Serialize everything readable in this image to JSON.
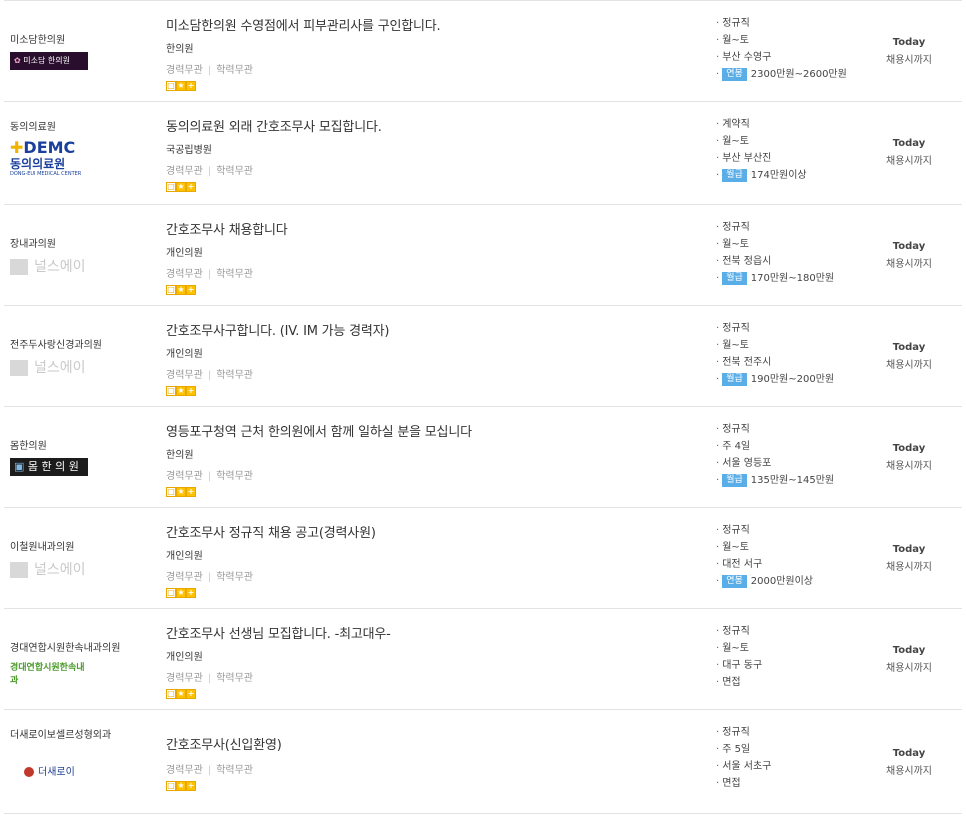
{
  "jobs": [
    {
      "company": "미소담한의원",
      "logo_text": "미소담 한의원",
      "title": "미소담한의원 수영점에서 피부관리사를 구인합니다.",
      "org": "한의원",
      "experience": "경력무관",
      "education": "학력무관",
      "conditions": [
        "정규직",
        "월~토",
        "부산 수영구"
      ],
      "pay_type": "연봉",
      "pay": "2300만원~2600만원",
      "deadline_1": "Today",
      "deadline_2": "채용시까지"
    },
    {
      "company": "동의의료원",
      "logo_text": "DEMC 동의의료원",
      "logo_sub": "DONG-EUI MEDICAL CENTER",
      "title": "동의의료원 외래 간호조무사 모집합니다.",
      "org": "국공립병원",
      "experience": "경력무관",
      "education": "학력무관",
      "conditions": [
        "계약직",
        "월~토",
        "부산 부산진"
      ],
      "pay_type": "월급",
      "pay": "174만원이상",
      "deadline_1": "Today",
      "deadline_2": "채용시까지"
    },
    {
      "company": "장내과의원",
      "logo_text": "널스에이",
      "title": "간호조무사 채용합니다",
      "org": "개인의원",
      "experience": "경력무관",
      "education": "학력무관",
      "conditions": [
        "정규직",
        "월~토",
        "전북 정읍시"
      ],
      "pay_type": "월급",
      "pay": "170만원~180만원",
      "deadline_1": "Today",
      "deadline_2": "채용시까지"
    },
    {
      "company": "전주두사랑신경과의원",
      "logo_text": "널스에이",
      "title": "간호조무사구합니다. (IV. IM 가능 경력자)",
      "org": "개인의원",
      "experience": "경력무관",
      "education": "학력무관",
      "conditions": [
        "정규직",
        "월~토",
        "전북 전주시"
      ],
      "pay_type": "월급",
      "pay": "190만원~200만원",
      "deadline_1": "Today",
      "deadline_2": "채용시까지"
    },
    {
      "company": "몸한의원",
      "logo_text": "몸 한 의 원",
      "title": "영등포구청역 근처 한의원에서 함께 일하실 분을 모십니다",
      "org": "한의원",
      "experience": "경력무관",
      "education": "학력무관",
      "conditions": [
        "정규직",
        "주 4일",
        "서울 영등포"
      ],
      "pay_type": "월급",
      "pay": "135만원~145만원",
      "deadline_1": "Today",
      "deadline_2": "채용시까지"
    },
    {
      "company": "이철원내과의원",
      "logo_text": "널스에이",
      "title": "간호조무사 정규직 채용 공고(경력사원)",
      "org": "개인의원",
      "experience": "경력무관",
      "education": "학력무관",
      "conditions": [
        "정규직",
        "월~토",
        "대전 서구"
      ],
      "pay_type": "연봉",
      "pay": "2000만원이상",
      "deadline_1": "Today",
      "deadline_2": "채용시까지"
    },
    {
      "company": "경대연합시원한속내과의원",
      "logo_text": "경대연합시원한속내과",
      "title": "간호조무사 선생님 모집합니다. -최고대우-",
      "org": "개인의원",
      "experience": "경력무관",
      "education": "학력무관",
      "conditions": [
        "정규직",
        "월~토",
        "대구 동구",
        "면접"
      ],
      "pay_type": "",
      "pay": "",
      "deadline_1": "Today",
      "deadline_2": "채용시까지"
    },
    {
      "company": "더새로이보셀르성형외과",
      "logo_text": "더새로이",
      "title": "간호조무사(신입환영)",
      "org": "",
      "experience": "경력무관",
      "education": "학력무관",
      "conditions": [
        "정규직",
        "주 5일",
        "서울 서초구",
        "면접"
      ],
      "pay_type": "",
      "pay": "",
      "deadline_1": "Today",
      "deadline_2": "채용시까지"
    }
  ]
}
